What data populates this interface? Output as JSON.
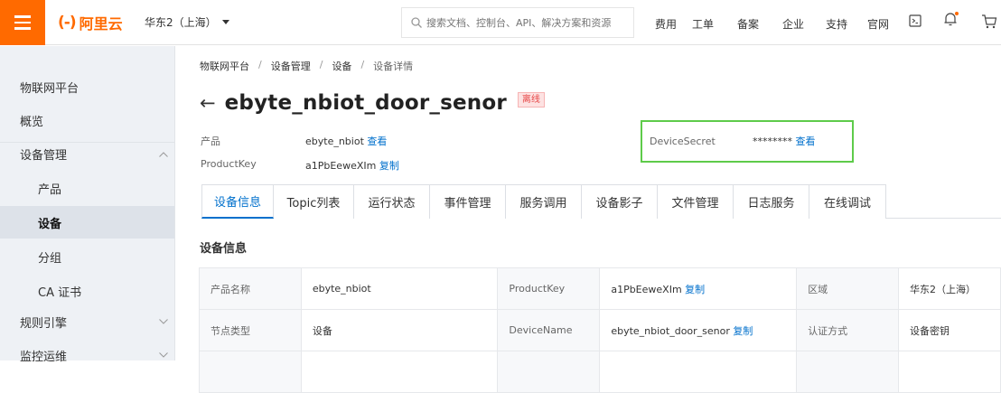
{
  "header": {
    "logo_mark": "(-)",
    "logo_text": "阿里云",
    "region": "华东2（上海）",
    "search_placeholder": "搜索文档、控制台、API、解决方案和资源",
    "nav": [
      "费用",
      "工单",
      "备案",
      "企业",
      "支持",
      "官网"
    ],
    "accent": "#ff6a00"
  },
  "sidebar": {
    "title": "物联网平台",
    "items": [
      {
        "label": "概览"
      },
      {
        "label": "设备管理"
      },
      {
        "label": "产品"
      },
      {
        "label": "设备"
      },
      {
        "label": "分组"
      },
      {
        "label": "CA 证书"
      },
      {
        "label": "规则引擎"
      },
      {
        "label": "监控运维"
      }
    ]
  },
  "breadcrumb": [
    "物联网平台",
    "设备管理",
    "设备",
    "设备详情"
  ],
  "device": {
    "name": "ebyte_nbiot_door_senor",
    "status": "离线",
    "product_label": "产品",
    "product_value": "ebyte_nbiot",
    "product_link": "查看",
    "productkey_label": "ProductKey",
    "productkey_value": "a1PbEeweXIm",
    "productkey_link": "复制",
    "secret_label": "DeviceSecret",
    "secret_value": "********",
    "secret_link": "查看"
  },
  "tabs": [
    {
      "label": "设备信息",
      "active": true
    },
    {
      "label": "Topic列表"
    },
    {
      "label": "运行状态"
    },
    {
      "label": "事件管理"
    },
    {
      "label": "服务调用"
    },
    {
      "label": "设备影子"
    },
    {
      "label": "文件管理"
    },
    {
      "label": "日志服务"
    },
    {
      "label": "在线调试"
    }
  ],
  "section_title": "设备信息",
  "info_table": {
    "rows": [
      [
        "产品名称",
        "ebyte_nbiot",
        "ProductKey",
        "a1PbEeweXIm",
        "区域",
        "华东2（上海）"
      ],
      [
        "节点类型",
        "设备",
        "DeviceName",
        "ebyte_nbiot_door_senor",
        "认证方式",
        "设备密钥"
      ]
    ],
    "copy_link": "复制"
  }
}
